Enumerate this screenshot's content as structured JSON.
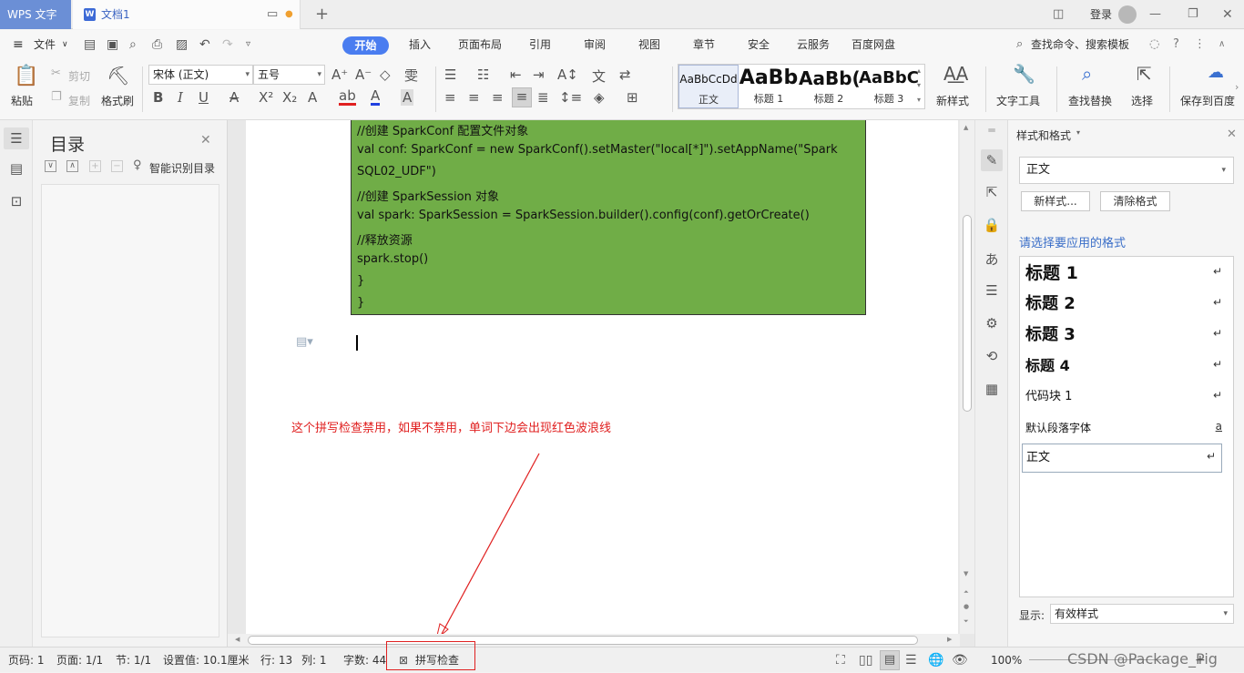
{
  "titlebar": {
    "app_name": "WPS 文字",
    "doc_tab": "文档1",
    "login": "登录"
  },
  "menu": {
    "file": "文件",
    "items": [
      "开始",
      "插入",
      "页面布局",
      "引用",
      "审阅",
      "视图",
      "章节",
      "安全",
      "云服务",
      "百度网盘"
    ],
    "active": "开始",
    "search": "查找命令、搜索模板"
  },
  "ribbon": {
    "paste": "粘贴",
    "cut": "剪切",
    "copy": "复制",
    "format_painter": "格式刷",
    "font_name": "宋体 (正文)",
    "font_size": "五号",
    "styles": [
      {
        "preview": "AaBbCcDd",
        "label": "正文"
      },
      {
        "preview": "AaBb",
        "label": "标题 1"
      },
      {
        "preview": "AaBb(",
        "label": "标题 2"
      },
      {
        "preview": "AaBbC",
        "label": "标题 3"
      }
    ],
    "new_style": "新样式",
    "text_tools": "文字工具",
    "find_replace": "查找替换",
    "select": "选择",
    "save_to_baidu": "保存到百度"
  },
  "toc": {
    "title": "目录",
    "smart": "智能识别目录"
  },
  "document": {
    "code_lines": [
      "  //创建 SparkConf 配置文件对象",
      "   val conf: SparkConf = new SparkConf().setMaster(\"local[*]\").setAppName(\"Spark",
      "SQL02_UDF\")",
      "  //创建 SparkSession 对象",
      "  val spark: SparkSession = SparkSession.builder().config(conf).getOrCreate()",
      "     //释放资源",
      "  spark.stop()",
      "  }",
      "}"
    ],
    "annotation": "这个拼写检查禁用，如果不禁用，单词下边会出现红色波浪线"
  },
  "style_panel": {
    "title": "样式和格式",
    "current": "正文",
    "new_style_btn": "新样式...",
    "clear_btn": "清除格式",
    "apply_label": "请选择要应用的格式",
    "styles": [
      {
        "name": "标题  1",
        "mark": "↵"
      },
      {
        "name": "标题  2",
        "mark": "↵"
      },
      {
        "name": "标题  3",
        "mark": "↵"
      },
      {
        "name": "标题  4",
        "mark": "↵"
      },
      {
        "name": "代码块 1",
        "mark": "↵"
      },
      {
        "name": "默认段落字体",
        "mark": "a"
      },
      {
        "name": "正文",
        "mark": "↵"
      }
    ],
    "show_label": "显示:",
    "show_value": "有效样式"
  },
  "statusbar": {
    "page_num": "页码: 1",
    "pages": "页面: 1/1",
    "section": "节: 1/1",
    "setting": "设置值: 10.1厘米",
    "row": "行: 13",
    "col": "列: 1",
    "words": "字数: 44",
    "spell": "拼写检查",
    "zoom": "100%",
    "watermark": "CSDN @Package_Pig"
  },
  "colors": {
    "accent": "#4a7df0",
    "code_bg": "#70ad47",
    "annotation": "#e02020"
  }
}
